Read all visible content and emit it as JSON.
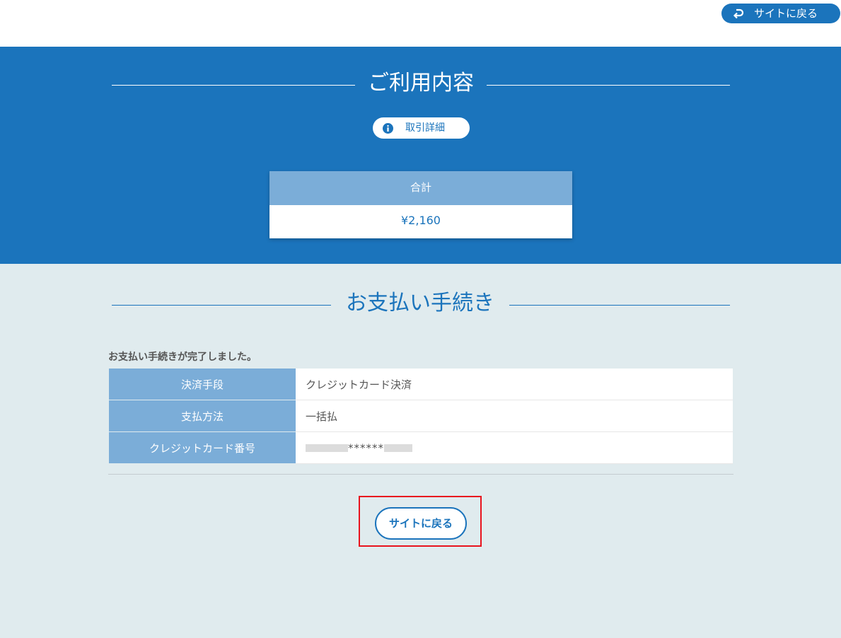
{
  "header": {
    "back_button_label": "サイトに戻る",
    "back_icon": "return-arrow-icon"
  },
  "usage": {
    "title": "ご利用内容",
    "detail_button_label": "取引詳細",
    "detail_icon": "info-icon",
    "total_label": "合計",
    "total_value": "¥2,160"
  },
  "payment": {
    "title": "お支払い手続き",
    "complete_message": "お支払い手続きが完了しました。",
    "rows": [
      {
        "label": "決済手段",
        "value": "クレジットカード決済"
      },
      {
        "label": "支払方法",
        "value": "一括払"
      },
      {
        "label": "クレジットカード番号",
        "value": "******"
      }
    ],
    "back_button_label": "サイトに戻る"
  },
  "colors": {
    "primary": "#1b74bc",
    "header_cell": "#7badd8",
    "section_bg": "#e0ebee",
    "highlight": "#e8141e"
  }
}
